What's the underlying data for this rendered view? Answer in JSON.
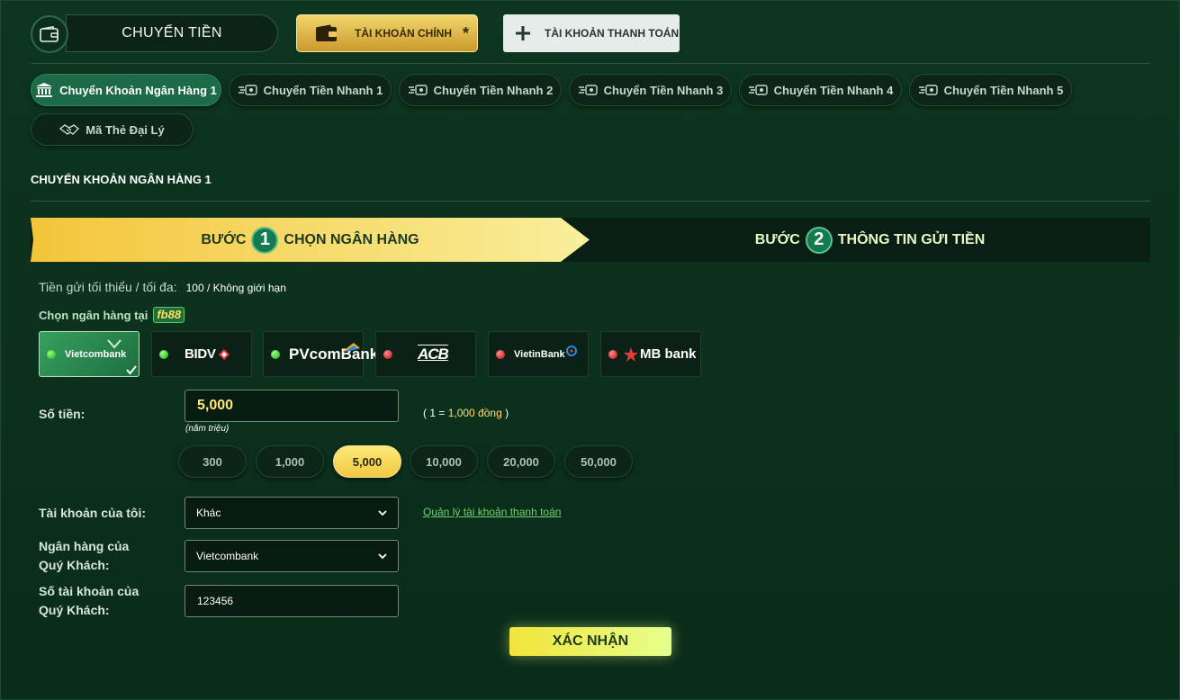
{
  "header": {
    "title": "CHUYỂN TIỀN",
    "main_account_label": "TÀI KHOẢN CHÍNH",
    "main_account_star": "*",
    "payment_account_label": "TÀI KHOẢN THANH TOÁN"
  },
  "tabs": [
    {
      "label": "Chuyển Khoản Ngân Hàng 1",
      "icon": "bank-icon",
      "active": true
    },
    {
      "label": "Chuyển Tiền Nhanh 1",
      "icon": "fast-transfer-icon"
    },
    {
      "label": "Chuyển Tiền Nhanh 2",
      "icon": "fast-transfer-icon"
    },
    {
      "label": "Chuyển Tiền Nhanh 3",
      "icon": "fast-transfer-icon"
    },
    {
      "label": "Chuyển Tiền Nhanh 4",
      "icon": "fast-transfer-icon"
    },
    {
      "label": "Chuyển Tiền Nhanh 5",
      "icon": "fast-transfer-icon"
    },
    {
      "label": "Mã Thẻ Đại Lý",
      "icon": "handshake-icon"
    }
  ],
  "section_title": "CHUYỂN KHOẢN NGÂN HÀNG 1",
  "steps": {
    "step_word": "BƯỚC",
    "step1": {
      "num": "1",
      "label": "CHỌN NGÂN HÀNG"
    },
    "step2": {
      "num": "2",
      "label": "THÔNG TIN GỬI TIỀN"
    }
  },
  "limits": {
    "label": "Tiền gửi tối thiểu / tối đa:",
    "value": "100 / Không giới hạn"
  },
  "choose_bank": {
    "label": "Chọn ngân hàng tại",
    "brand": "fb88"
  },
  "banks": [
    {
      "name": "Vietcombank",
      "status": "green",
      "selected": true
    },
    {
      "name": "BIDV",
      "status": "green"
    },
    {
      "name": "PVcomBank",
      "status": "green"
    },
    {
      "name": "ACB",
      "status": "red"
    },
    {
      "name": "VietinBank",
      "status": "red"
    },
    {
      "name": "MB bank",
      "status": "red"
    }
  ],
  "form": {
    "amount_label": "Số tiền:",
    "amount_value": "5,000",
    "amount_words": "(năm triệu)",
    "rate_open": "( 1 = ",
    "rate_value": "1,000 đồng",
    "rate_close": " )",
    "chips": [
      "300",
      "1,000",
      "5,000",
      "10,000",
      "20,000",
      "50,000"
    ],
    "active_chip": 2,
    "my_account_label": "Tài khoản của tôi:",
    "my_account_value": "Khác",
    "manage_link": "Quản lý tài khoản thanh toán",
    "bank_label_1": "Ngân hàng của",
    "bank_label_2": "Quý Khách:",
    "bank_value": "Vietcombank",
    "acct_label_1": "Số tài khoản của",
    "acct_label_2": "Quý Khách:",
    "acct_value": "123456",
    "confirm": "XÁC NHẬN"
  },
  "colors": {
    "accent_gold": "#f4c53a",
    "active_green": "#1c6a46",
    "confirm": "#f2e43a"
  }
}
